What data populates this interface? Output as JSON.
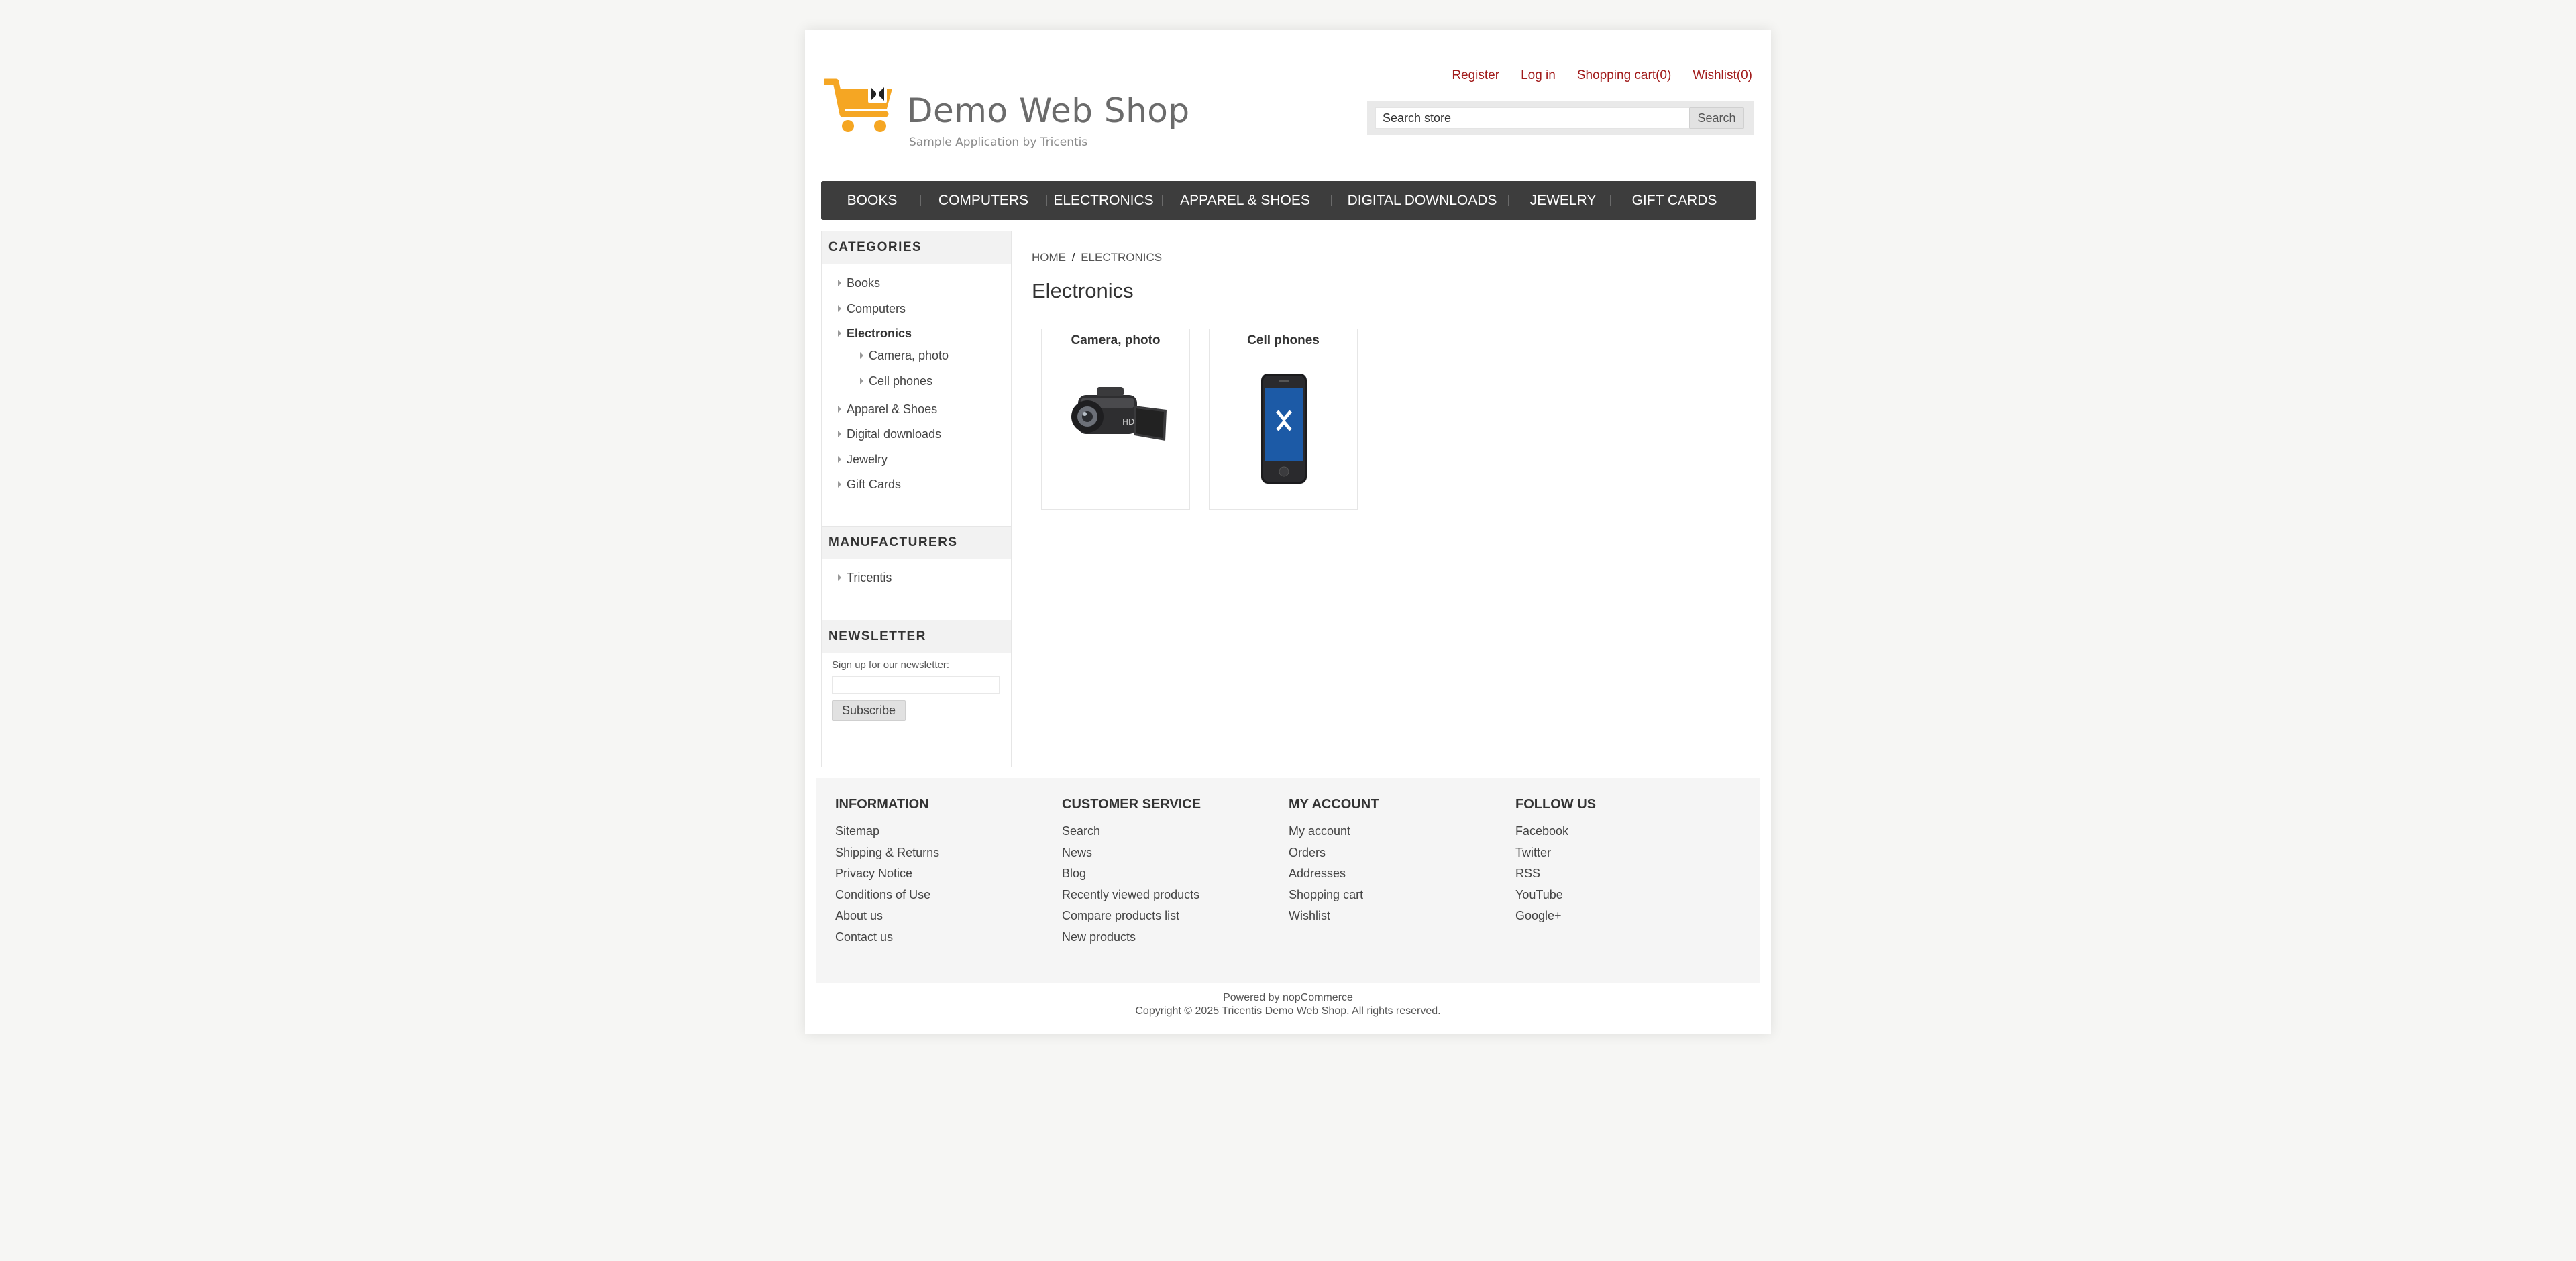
{
  "logo": {
    "title": "Demo Web Shop",
    "subtitle": "Sample Application by Tricentis",
    "icon": "shopping-cart-logo"
  },
  "header_links": {
    "register": "Register",
    "login": "Log in",
    "cart": "Shopping cart(0)",
    "wishlist": "Wishlist(0)"
  },
  "search": {
    "value": "Search store",
    "button": "Search"
  },
  "menu": [
    "BOOKS",
    "COMPUTERS",
    "ELECTRONICS",
    "APPAREL & SHOES",
    "DIGITAL DOWNLOADS",
    "JEWELRY",
    "GIFT CARDS"
  ],
  "categories": {
    "title": "CATEGORIES",
    "items": [
      "Books",
      "Computers",
      "Electronics",
      "Camera, photo",
      "Cell phones",
      "Apparel & Shoes",
      "Digital downloads",
      "Jewelry",
      "Gift Cards"
    ]
  },
  "manufacturers": {
    "title": "MANUFACTURERS",
    "items": [
      "Tricentis"
    ]
  },
  "newsletter": {
    "title": "NEWSLETTER",
    "text": "Sign up for our newsletter:",
    "button": "Subscribe"
  },
  "breadcrumb": {
    "home": "HOME",
    "separator": "/",
    "current": "ELECTRONICS"
  },
  "page_title": "Electronics",
  "subcategories": [
    "Camera, photo",
    "Cell phones"
  ],
  "footer": {
    "information": {
      "title": "INFORMATION",
      "links": [
        "Sitemap",
        "Shipping & Returns",
        "Privacy Notice",
        "Conditions of Use",
        "About us",
        "Contact us"
      ]
    },
    "customer_service": {
      "title": "CUSTOMER SERVICE",
      "links": [
        "Search",
        "News",
        "Blog",
        "Recently viewed products",
        "Compare products list",
        "New products"
      ]
    },
    "my_account": {
      "title": "MY ACCOUNT",
      "links": [
        "My account",
        "Orders",
        "Addresses",
        "Shopping cart",
        "Wishlist"
      ]
    },
    "follow_us": {
      "title": "FOLLOW US",
      "links": [
        "Facebook",
        "Twitter",
        "RSS",
        "YouTube",
        "Google+"
      ]
    }
  },
  "powered": "Powered by nopCommerce",
  "copyright": "Copyright © 2025 Tricentis Demo Web Shop. All rights reserved.",
  "colors": {
    "link_red": "#a11b1b",
    "menu_bg": "#3d3d3d",
    "accent_orange": "#f5a623"
  }
}
